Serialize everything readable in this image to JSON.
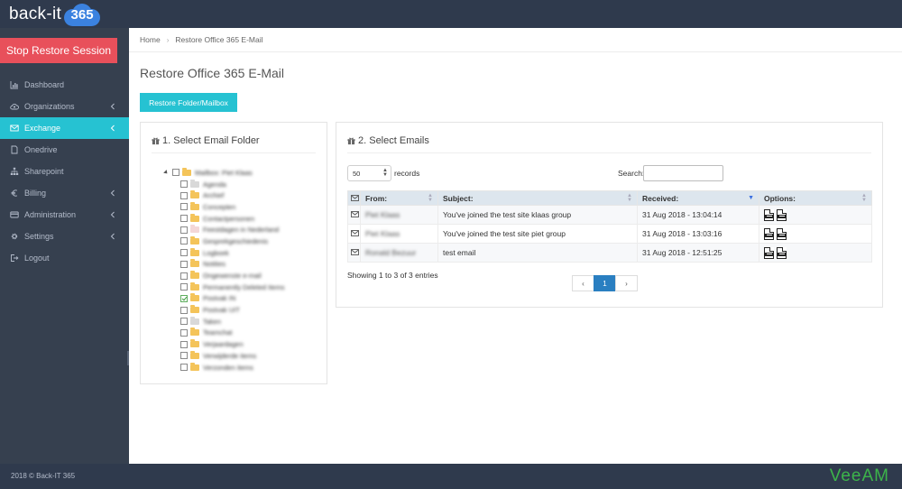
{
  "app": {
    "logo_text": "back-it",
    "logo_badge": "365"
  },
  "sidebar": {
    "stop_label": "Stop Restore Session",
    "items": [
      {
        "label": "Dashboard",
        "icon": "chart-icon",
        "active": false,
        "has_chevron": false
      },
      {
        "label": "Organizations",
        "icon": "cloud-upload-icon",
        "active": false,
        "has_chevron": true
      },
      {
        "label": "Exchange",
        "icon": "envelope-icon",
        "active": true,
        "has_chevron": true
      },
      {
        "label": "Onedrive",
        "icon": "document-icon",
        "active": false,
        "has_chevron": false
      },
      {
        "label": "Sharepoint",
        "icon": "sitemap-icon",
        "active": false,
        "has_chevron": false
      },
      {
        "label": "Billing",
        "icon": "euro-icon",
        "active": false,
        "has_chevron": true
      },
      {
        "label": "Administration",
        "icon": "credit-card-icon",
        "active": false,
        "has_chevron": true
      },
      {
        "label": "Settings",
        "icon": "gear-icon",
        "active": false,
        "has_chevron": true
      },
      {
        "label": "Logout",
        "icon": "logout-icon",
        "active": false,
        "has_chevron": false
      }
    ]
  },
  "breadcrumb": {
    "home": "Home",
    "separator": "›",
    "current": "Restore Office 365 E-Mail"
  },
  "page": {
    "title": "Restore Office 365 E-Mail",
    "restore_button": "Restore Folder/Mailbox"
  },
  "folder_panel": {
    "heading": "1. Select Email Folder",
    "root": "Mailbox: Piet Klaas",
    "folders": [
      {
        "label": "Agenda",
        "color": "gray",
        "checked": false
      },
      {
        "label": "Archief",
        "color": "yellow",
        "checked": false
      },
      {
        "label": "Concepten",
        "color": "yellow",
        "checked": false
      },
      {
        "label": "Contactpersonen",
        "color": "yellow",
        "checked": false
      },
      {
        "label": "Feestdagen in Nederland",
        "color": "pink",
        "checked": false
      },
      {
        "label": "Gesprekgeschiedenis",
        "color": "yellow",
        "checked": false
      },
      {
        "label": "Logboek",
        "color": "yellow",
        "checked": false
      },
      {
        "label": "Notities",
        "color": "yellow",
        "checked": false
      },
      {
        "label": "Ongewenste e-mail",
        "color": "yellow",
        "checked": false
      },
      {
        "label": "Permanently Deleted Items",
        "color": "yellow",
        "checked": false
      },
      {
        "label": "Postvak IN",
        "color": "yellow",
        "checked": true
      },
      {
        "label": "Postvak UIT",
        "color": "yellow",
        "checked": false
      },
      {
        "label": "Taken",
        "color": "gray",
        "checked": false
      },
      {
        "label": "Teamchat",
        "color": "yellow",
        "checked": false
      },
      {
        "label": "Verjaardagen",
        "color": "yellow",
        "checked": false
      },
      {
        "label": "Verwijderde items",
        "color": "yellow",
        "checked": false
      },
      {
        "label": "Verzonden items",
        "color": "yellow",
        "checked": false
      }
    ]
  },
  "emails_panel": {
    "heading": "2. Select Emails",
    "length_value": "50",
    "records_label": "records",
    "search_label": "Search:",
    "search_value": "",
    "columns": {
      "from": "From:",
      "subject": "Subject:",
      "received": "Received:",
      "options": "Options:"
    },
    "rows": [
      {
        "from": "Piet Klaas",
        "subject": "You've joined the test site klaas group",
        "received": "31 Aug 2018 - 13:04:14"
      },
      {
        "from": "Piet Klaas",
        "subject": "You've joined the test site piet group",
        "received": "31 Aug 2018 - 13:03:16"
      },
      {
        "from": "Ronald Bezuur",
        "subject": "test email",
        "received": "31 Aug 2018 - 12:51:25"
      }
    ],
    "showing": "Showing 1 to 3 of 3 entries",
    "pager": {
      "prev": "‹",
      "page": "1",
      "next": "›"
    }
  },
  "footer": {
    "copyright": "2018 © Back-IT 365",
    "brand": "VeeAM"
  },
  "colors": {
    "accent": "#26c2d2",
    "danger": "#e8505b",
    "sidebar": "#36404f",
    "topbar": "#2f3a4d",
    "page_active": "#2a7fc1",
    "veeam": "#3cb54a"
  }
}
